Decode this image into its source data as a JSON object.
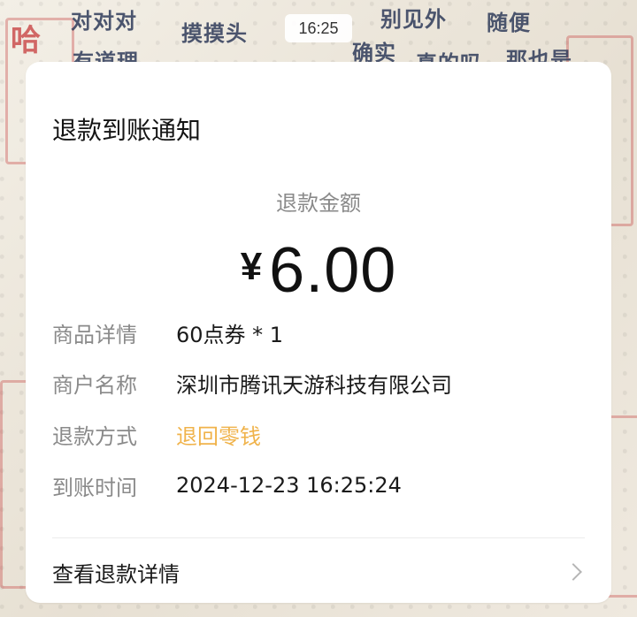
{
  "status_bar": {
    "time": "16:25"
  },
  "background": {
    "words": [
      "对对对",
      "摸摸头",
      "别见外",
      "随便",
      "哈",
      "确实",
      "有道理",
      "那也是",
      "真的吗"
    ]
  },
  "notice": {
    "title": "退款到账通知",
    "amount_label": "退款金额",
    "currency": "¥",
    "amount": "6.00",
    "rows": [
      {
        "label": "商品详情",
        "value": "60点券 * 1"
      },
      {
        "label": "商户名称",
        "value": "深圳市腾讯天游科技有限公司"
      },
      {
        "label": "退款方式",
        "value": "退回零钱",
        "accent": "#f0b34b"
      },
      {
        "label": "到账时间",
        "value": "2024-12-23 16:25:24"
      }
    ],
    "footer_link": "查看退款详情",
    "chevron_icon": "chevron-right-icon"
  }
}
